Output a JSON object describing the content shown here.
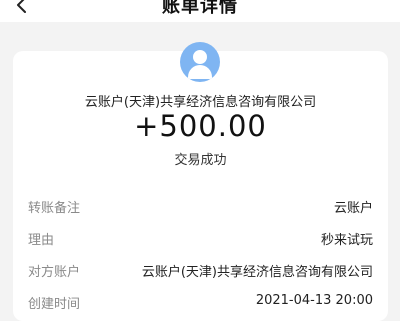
{
  "header": {
    "title": "账单详情"
  },
  "summary": {
    "avatar_icon": "person-icon",
    "company": "云账户(天津)共享经济信息咨询有限公司",
    "amount": "+500.00",
    "status": "交易成功"
  },
  "details": [
    {
      "label": "转账备注",
      "value": "云账户"
    },
    {
      "label": "理由",
      "value": "秒来试玩"
    },
    {
      "label": "对方账户",
      "value": "云账户(天津)共享经济信息咨询有限公司"
    },
    {
      "label": "创建时间",
      "value": "2021-04-13 20:00"
    }
  ],
  "colors": {
    "background": "#f3f3f3",
    "card": "#ffffff",
    "avatar": "#7fb5f2",
    "label": "#8a8a8a"
  }
}
